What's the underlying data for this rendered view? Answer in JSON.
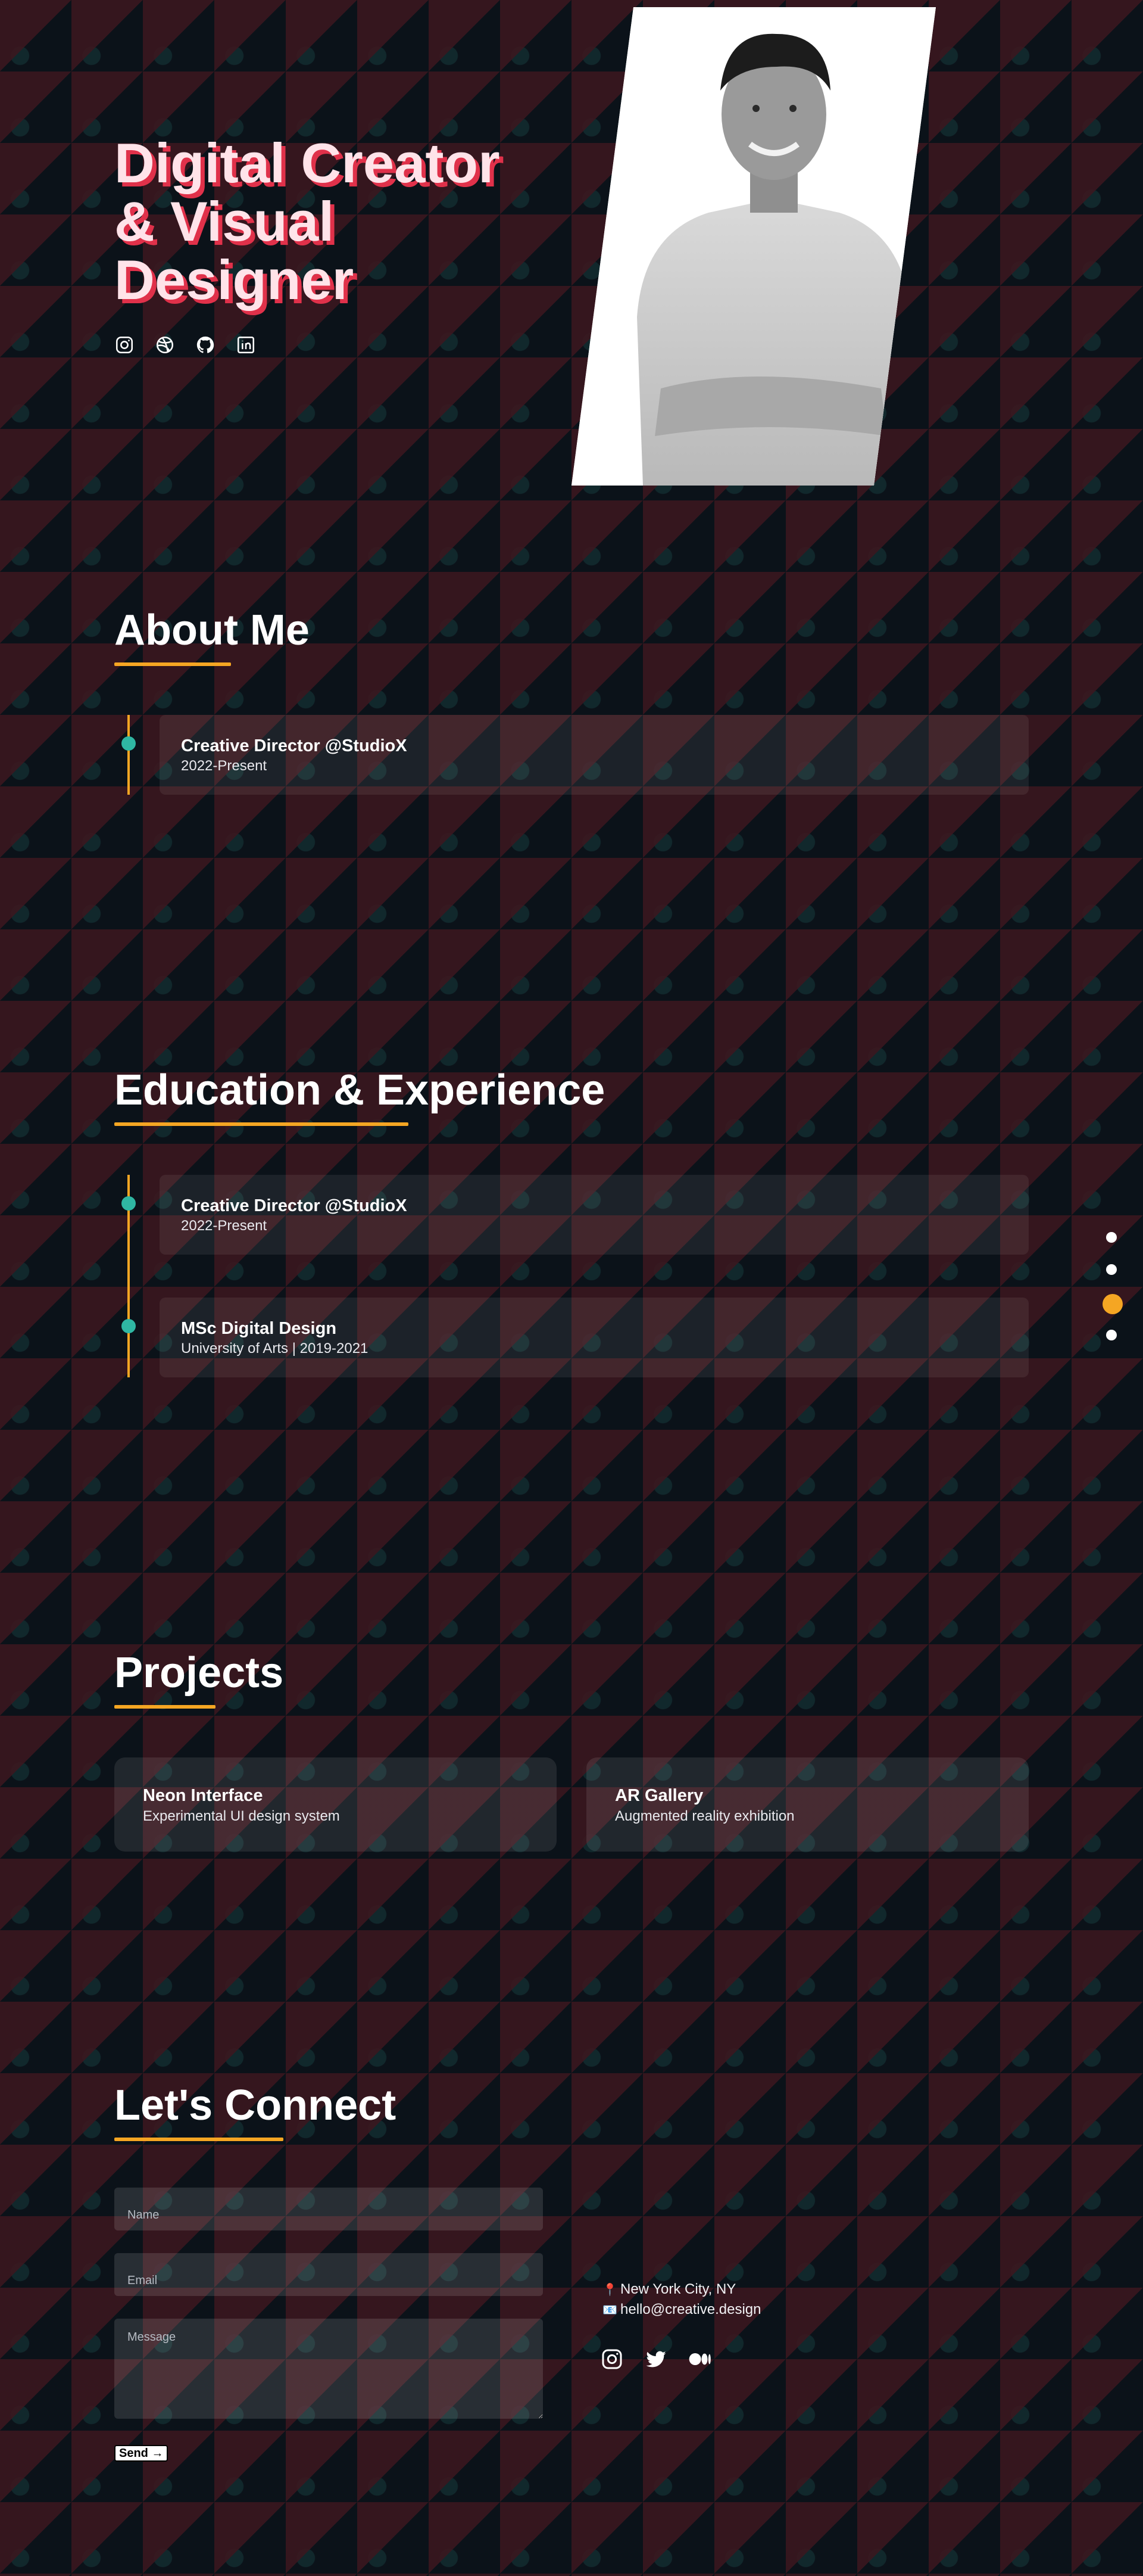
{
  "hero": {
    "title_line1": "Digital Creator",
    "title_line2": "& Visual",
    "title_line3": "Designer",
    "social_icons": [
      "instagram-icon",
      "dribbble-icon",
      "github-icon",
      "linkedin-icon"
    ]
  },
  "about": {
    "title": "About Me",
    "items": [
      {
        "title": "Creative Director @StudioX",
        "subtitle": "2022-Present"
      }
    ]
  },
  "education": {
    "title": "Education & Experience",
    "items": [
      {
        "title": "Creative Director @StudioX",
        "subtitle": "2022-Present"
      },
      {
        "title": "MSc Digital Design",
        "subtitle": "University of Arts | 2019-2021"
      }
    ]
  },
  "projects": {
    "title": "Projects",
    "items": [
      {
        "title": "Neon Interface",
        "subtitle": "Experimental UI design system"
      },
      {
        "title": "AR Gallery",
        "subtitle": "Augmented reality exhibition"
      }
    ]
  },
  "contact": {
    "title": "Let's Connect",
    "name_placeholder": "Name",
    "email_placeholder": "Email",
    "message_placeholder": "Message",
    "send_label": "Send →",
    "location_icon": "📍",
    "location": "New York City, NY",
    "email_icon": "📧",
    "email": "hello@creative.design",
    "social_icons": [
      "instagram-icon",
      "twitter-icon",
      "medium-icon"
    ]
  },
  "side_nav": {
    "count": 4,
    "active_index": 2
  },
  "colors": {
    "accent": "#f5a623",
    "teal": "#2fb7a3",
    "title_shadow": "#e0314a",
    "background": "#0b1219"
  }
}
